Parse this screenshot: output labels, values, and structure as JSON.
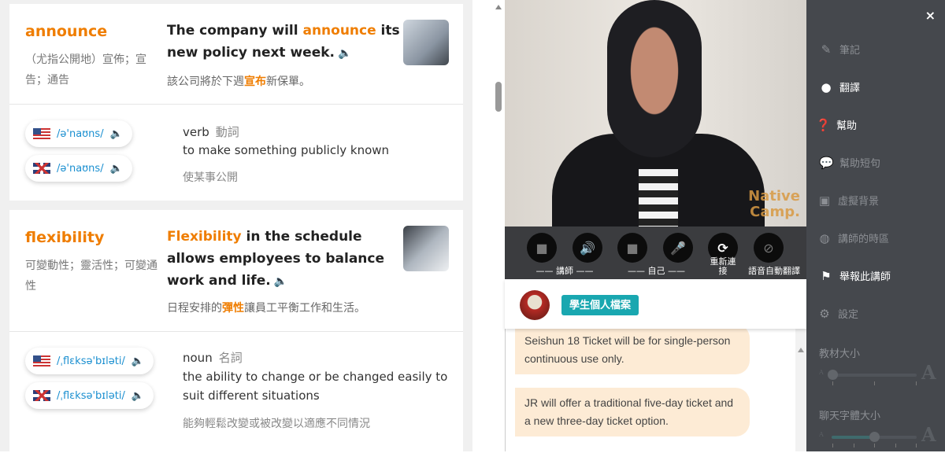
{
  "words": [
    {
      "word": "announce",
      "translation": "（尤指公開地）宣佈；宣告；通告",
      "example_pre": "The company will ",
      "example_hl": "announce",
      "example_post": " its new policy next week.",
      "example_tr_pre": "該公司將於下週",
      "example_tr_hl": "宣布",
      "example_tr_post": "新保單。",
      "us_ipa": "/ə'naʊns/",
      "uk_ipa": "/ə'naʊns/",
      "pos": "verb",
      "pos_zh": "動詞",
      "definition": "to make something publicly known",
      "definition_zh": "使某事公開"
    },
    {
      "word": "flexibility",
      "translation": "可變動性；靈活性；可變通性",
      "example_pre": "",
      "example_hl": "Flexibility",
      "example_post": " in the schedule allows employees to balance work and life.",
      "example_tr_pre": "日程安排的",
      "example_tr_hl": "彈性",
      "example_tr_post": "讓員工平衡工作和生活。",
      "us_ipa": "/ˌflɛksə'bɪləti/",
      "uk_ipa": "/ˌflɛksə'bɪləti/",
      "pos": "noun",
      "pos_zh": "名詞",
      "definition": "the ability to change or be changed easily to suit different situations",
      "definition_zh": "能夠輕鬆改變或被改變以適應不同情況"
    }
  ],
  "video": {
    "logo": "Native Camp."
  },
  "controls": {
    "teacher_label": "講師",
    "self_label": "自己",
    "reconnect_label": "重新連接",
    "auto_translate_label": "語音自動翻譯"
  },
  "profile": {
    "button": "學生個人檔案"
  },
  "chat": {
    "messages": [
      "Seishun 18 Ticket will be for single-person continuous use only.",
      "JR will offer a traditional five-day ticket and a new three-day ticket option."
    ]
  },
  "sidebar": {
    "close": "×",
    "items": [
      {
        "label": "筆記",
        "icon": "note-edit-icon",
        "active": false
      },
      {
        "label": "翻譯",
        "icon": "globe-icon",
        "active": true
      },
      {
        "label": "幫助",
        "icon": "question-icon",
        "active": true
      },
      {
        "label": "幫助短句",
        "icon": "chat-bubble-icon",
        "active": false
      },
      {
        "label": "虛擬背景",
        "icon": "image-icon",
        "active": false
      },
      {
        "label": "講師的時區",
        "icon": "world-clock-icon",
        "active": false
      },
      {
        "label": "舉報此講師",
        "icon": "flag-icon",
        "active": true
      },
      {
        "label": "設定",
        "icon": "gear-icon",
        "active": false
      }
    ],
    "material_size_label": "教材大小",
    "material_size_level": 0,
    "chat_font_size_label": "聊天字體大小",
    "chat_font_size_level": 0.5
  },
  "colors": {
    "accent": "#ef7d00",
    "link": "#1a8fd0",
    "profile_button": "#19a7b0",
    "chat_bubble": "#fdebd5",
    "sidebar": "#45484d"
  }
}
